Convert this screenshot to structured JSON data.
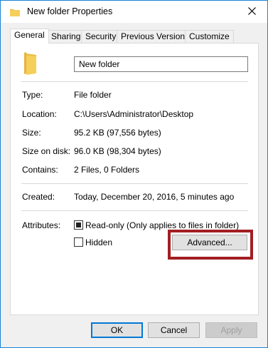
{
  "window": {
    "title": "New folder Properties",
    "close_icon": "close-icon",
    "folder_icon": "folder-icon"
  },
  "tabs": [
    {
      "label": "General",
      "active": true
    },
    {
      "label": "Sharing",
      "active": false
    },
    {
      "label": "Security",
      "active": false
    },
    {
      "label": "Previous Versions",
      "active": false
    },
    {
      "label": "Customize",
      "active": false
    }
  ],
  "general": {
    "name_value": "New folder",
    "properties": [
      {
        "label": "Type:",
        "value": "File folder"
      },
      {
        "label": "Location:",
        "value": "C:\\Users\\Administrator\\Desktop"
      },
      {
        "label": "Size:",
        "value": "95.2 KB (97,556 bytes)"
      },
      {
        "label": "Size on disk:",
        "value": "96.0 KB (98,304 bytes)"
      },
      {
        "label": "Contains:",
        "value": "2 Files, 0 Folders"
      }
    ],
    "created_label": "Created:",
    "created_value": "Today, December 20, 2016, 5 minutes ago",
    "attributes_label": "Attributes:",
    "readonly_label": "Read-only (Only applies to files in folder)",
    "readonly_checked": true,
    "hidden_label": "Hidden",
    "hidden_checked": false,
    "advanced_label": "Advanced..."
  },
  "footer": {
    "ok_label": "OK",
    "cancel_label": "Cancel",
    "apply_label": "Apply"
  },
  "colors": {
    "accent": "#0078d7",
    "highlight": "#a21e23",
    "folder": "#f6cf5a"
  }
}
